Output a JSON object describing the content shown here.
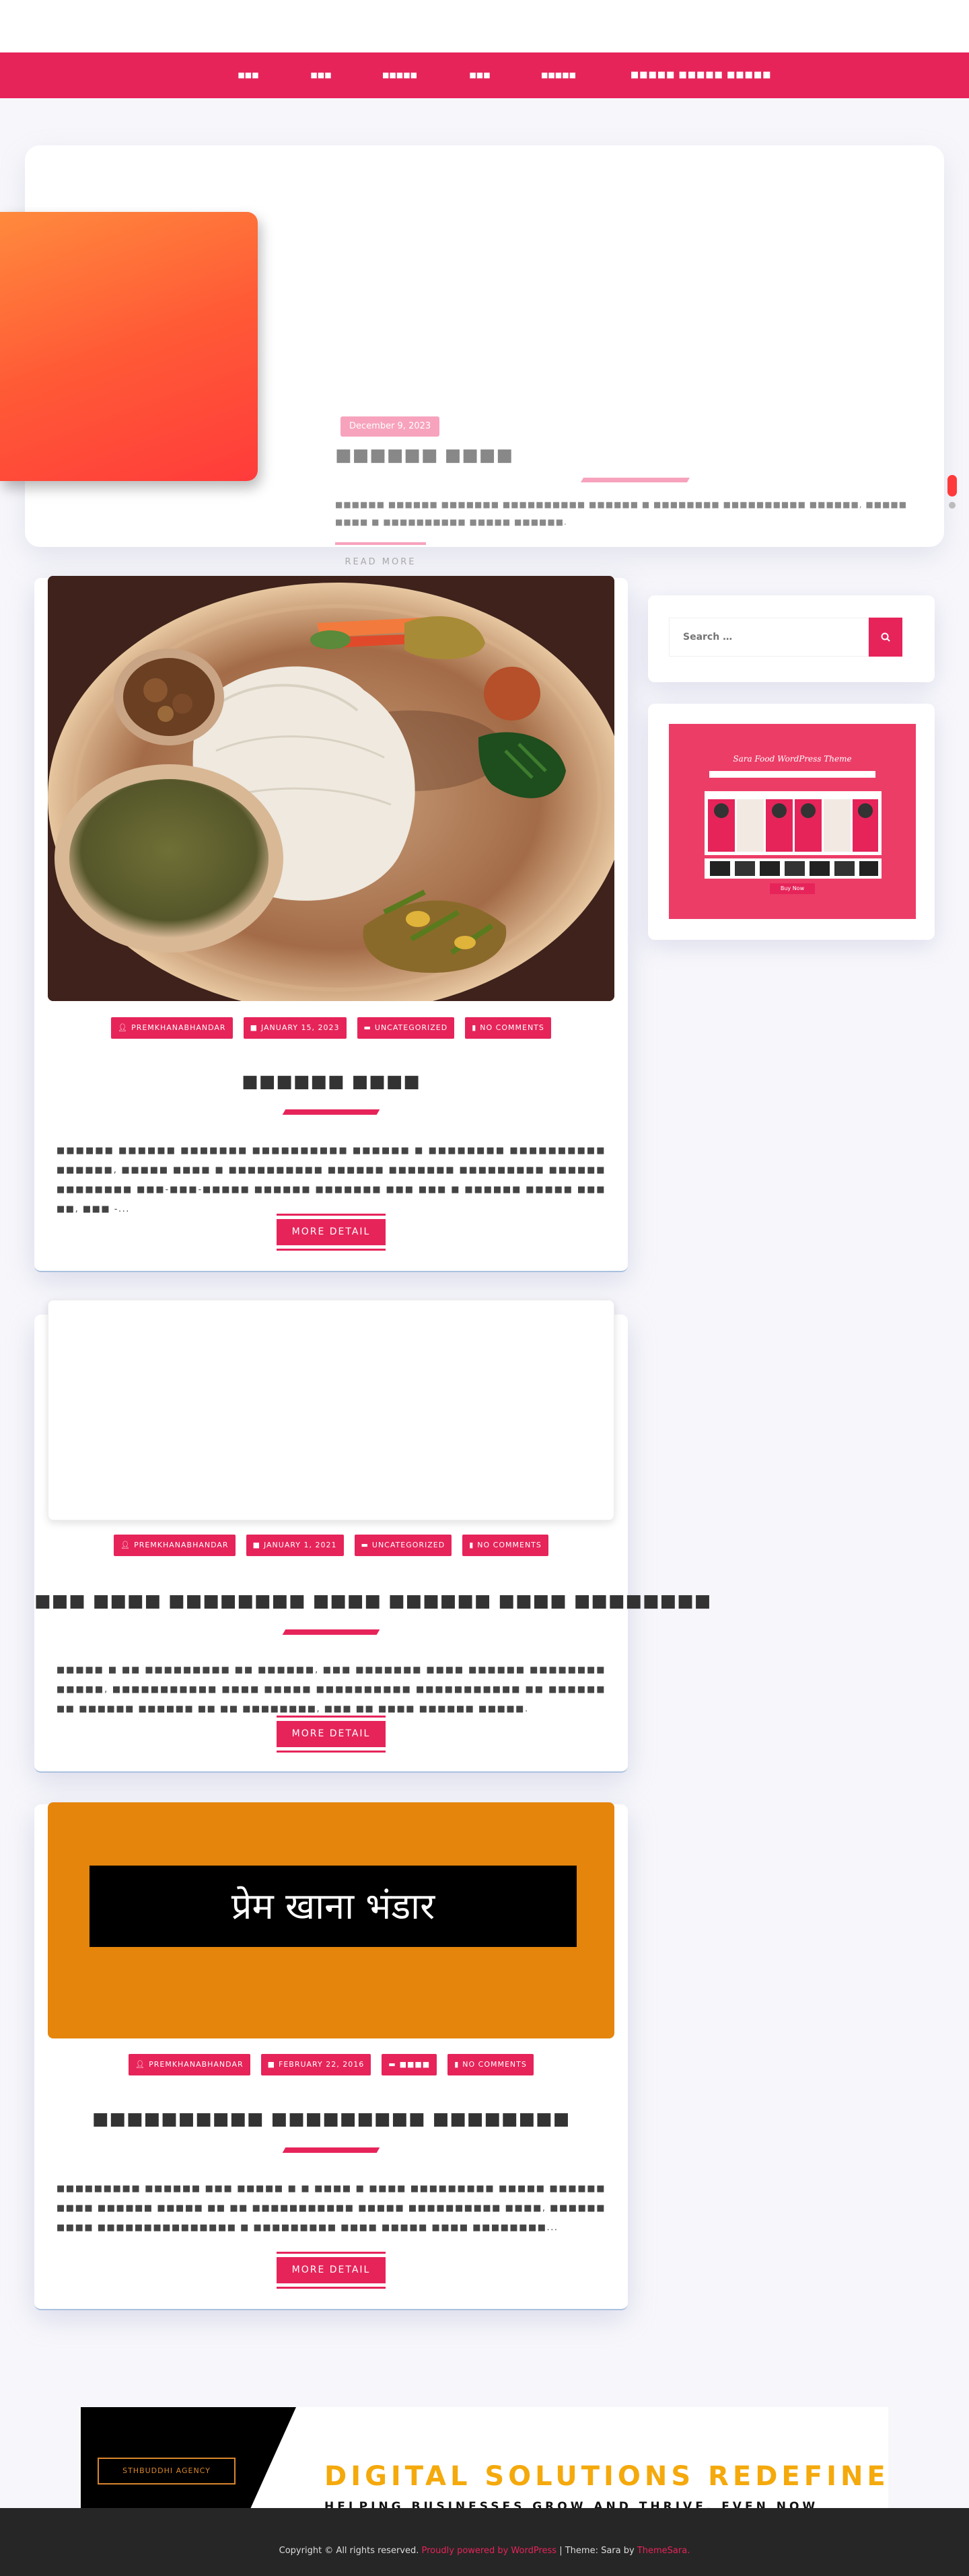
{
  "nav": {
    "items": [
      "■■■",
      "■■■",
      "■■■■■",
      "■■■",
      "■■■■■",
      "■■■■■ ■■■■■ ■■■■■"
    ]
  },
  "slider": {
    "date": "December 9, 2023",
    "title": "■■■■■■ ■■■■",
    "excerpt": "■■■■■■ ■■■■■■ ■■■■■■■ ■■■■■■■■■■ ■■■■■■ ■ ■■■■■■■■ ■■■■■■■■■■ ■■■■■■, ■■■■■ ■■■■ ■ ■■■■■■■■■■ ■■■■■ ■■■■■■.",
    "read_more": "READ MORE"
  },
  "posts": [
    {
      "author": "PREMKHANABHANDAR",
      "date": "JANUARY 15, 2023",
      "category": "UNCATEGORIZED",
      "comments": "NO COMMENTS",
      "title": "■■■■■■ ■■■■",
      "excerpt": "■■■■■■ ■■■■■■ ■■■■■■■ ■■■■■■■■■■ ■■■■■■ ■ ■■■■■■■■ ■■■■■■■■■■ ■■■■■■, ■■■■■ ■■■■ ■ ■■■■■■■■■■ ■■■■■■ ■■■■■■■ ■■■■■■■■■ ■■■■■■ ■■■■■■■■ ■■■-■■■-■■■■■ ■■■■■■ ■■■■■■■ ■■■ ■■■ ■ ■■■■■■ ■■■■■ ■■■ ■■, ■■■ -...",
      "more": "MORE DETAIL"
    },
    {
      "author": "PREMKHANABHANDAR",
      "date": "JANUARY 1, 2021",
      "category": "UNCATEGORIZED",
      "comments": "NO COMMENTS",
      "title": "■■■ ■■■■ ■■■■■■■■ ■■■■ ■■■■■■ ■■■■ ■■■■■■■■",
      "excerpt": "■■■■■ ■ ■■ ■■■■■■■■■ ■■ ■■■■■■, ■■■ ■■■■■■■ ■■■■ ■■■■■■ ■■■■■■■■ ■■■■■, ■■■■■■■■■■■ ■■■■ ■■■■■ ■■■■■■■■■■ ■■■■■■■■■■■ ■■ ■■■■■■ ■■ ■■■■■■ ■■■■■■ ■■ ■■ ■■■■■■■■, ■■■ ■■ ■■■■ ■■■■■■ ■■■■■.",
      "more": "MORE DETAIL"
    },
    {
      "author": "PREMKHANABHANDAR",
      "date": "FEBRUARY 22, 2016",
      "category": "■■■■",
      "comments": "NO COMMENTS",
      "title": "■■■■■■■■■■ ■■■■■■■■■ ■■■■■■■■",
      "excerpt": "■■■■■■■■■ ■■■■■■ ■■■ ■■■■■ ■ ■ ■■■■ ■ ■■■■ ■■■■■■■■■ ■■■■■ ■■■■■■ ■■■■ ■■■■■■ ■■■■■ ■■ ■■ ■■■■■■■■■■■ ■■■■■ ■■■■■■■■■■ ■■■■, ■■■■■■ ■■■■ ■■■■■■■■■■■■■■■ ■ ■■■■■■■■■ ■■■■ ■■■■■ ■■■■ ■■■■■■■■...",
      "more": "MORE DETAIL",
      "image_text": "प्रेम खाना भंडार"
    }
  ],
  "sidebar": {
    "search_placeholder": "Search …",
    "promo_title": "Sara Food WordPress Theme",
    "promo_button": "Buy Now"
  },
  "banner": {
    "agency": "STHBUDDHI AGENCY",
    "headline": "DIGITAL SOLUTIONS REDEFINED",
    "subline": "HELPING BUSINESSES GROW AND THRIVE, EVEN NOW"
  },
  "footer": {
    "copyright": "Copyright © All rights reserved.",
    "powered": "Proudly powered by WordPress",
    "sep": "|",
    "theme": "Theme: Sara by",
    "themesara": "ThemeSara."
  },
  "colors": {
    "brand": "#e6245a",
    "banner_orange": "#e5850b"
  }
}
